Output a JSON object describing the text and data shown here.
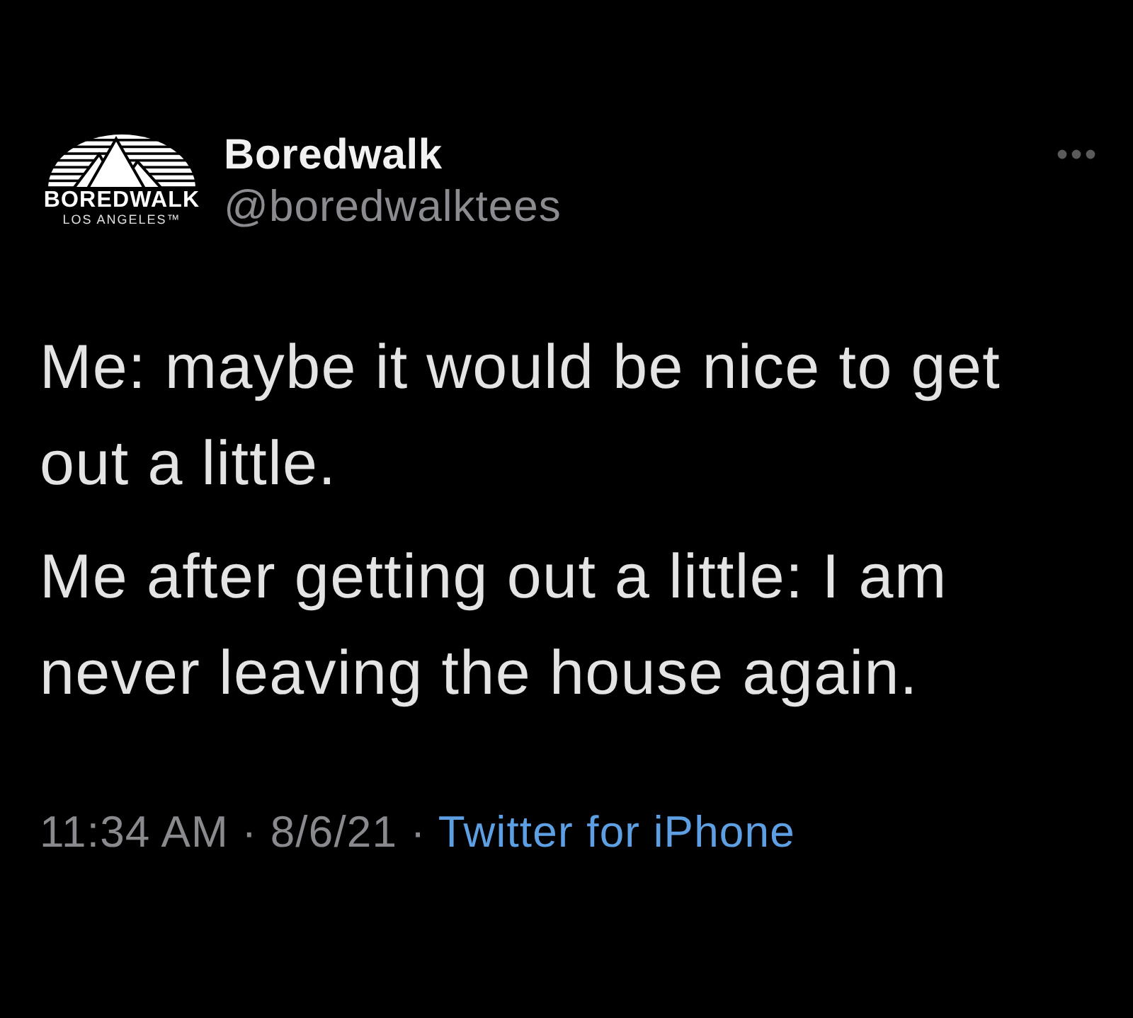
{
  "tweet": {
    "author": {
      "logo": {
        "wordmark": "BOREDWALK",
        "subtitle": "LOS ANGELES™"
      },
      "name": "Boredwalk",
      "handle": "@boredwalktees"
    },
    "paragraphs": [
      "Me: maybe it would be nice to get out a little.",
      "Me after getting out a little: I am never leaving the house again."
    ],
    "meta": {
      "timestamp": "11:34 AM · 8/6/21 ·",
      "source": "Twitter for iPhone"
    }
  }
}
